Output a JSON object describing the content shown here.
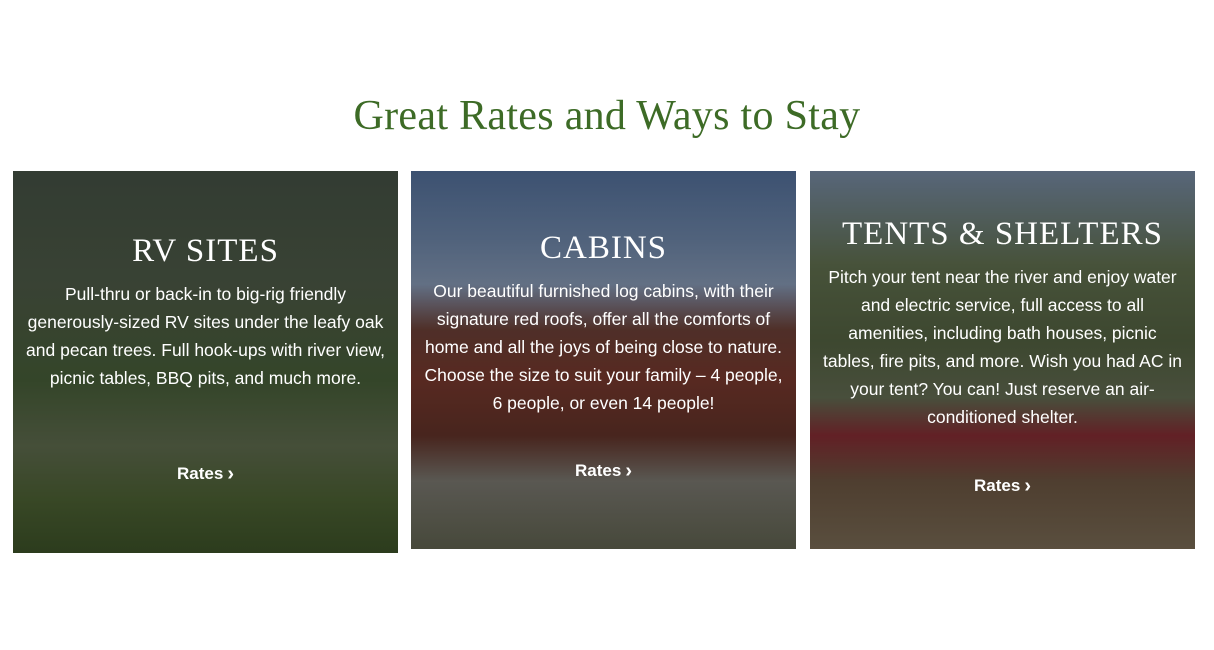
{
  "section": {
    "title": "Great Rates and Ways to Stay"
  },
  "cards": [
    {
      "title": "RV SITES",
      "description": "Pull-thru or back-in to big-rig friendly generously-sized RV sites under the leafy oak and pecan trees. Full hook-ups with river view, picnic tables, BBQ pits, and much more.",
      "link_label": "Rates"
    },
    {
      "title": "CABINS",
      "description": "Our beautiful furnished log cabins, with their signature red roofs, offer all the comforts of home and all the joys of being close to nature. Choose the size to suit your family – 4 people, 6 people, or even 14 people!",
      "link_label": "Rates"
    },
    {
      "title": "TENTS & SHELTERS",
      "description": "Pitch your tent near the river and enjoy water and electric service, full access to all amenities, including bath houses, picnic tables, fire pits, and more.  Wish you had AC in your tent?  You can! Just reserve an air-conditioned shelter.",
      "link_label": "Rates"
    }
  ],
  "colors": {
    "heading": "#3d6b26",
    "overlay_text": "#ffffff"
  },
  "icons": {
    "rates_arrow": "chevron-right-icon"
  }
}
